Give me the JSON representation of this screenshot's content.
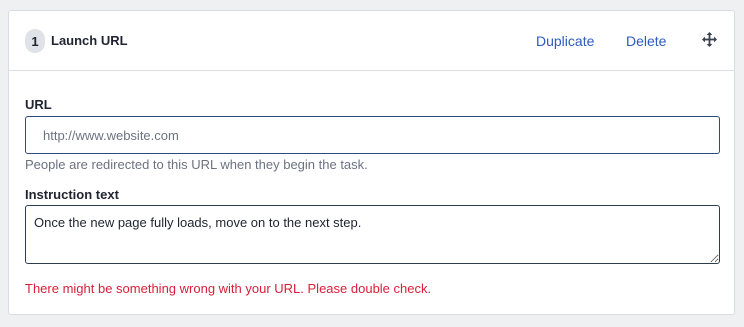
{
  "step": {
    "number": "1",
    "title": "Launch URL"
  },
  "actions": {
    "duplicate_label": "Duplicate",
    "delete_label": "Delete",
    "move_icon": "move-arrows-icon"
  },
  "url_field": {
    "label": "URL",
    "placeholder": "http://www.website.com",
    "value": "",
    "help_text": "People are redirected to this URL when they begin the task."
  },
  "instruction_field": {
    "label": "Instruction text",
    "value": "Once the new page fully loads, move on to the next step."
  },
  "error_message": "There might be something wrong with your URL. Please double check.",
  "colors": {
    "link": "#2d5bbe",
    "error": "#d8203b",
    "input_focus_border": "#2c4a7c"
  }
}
